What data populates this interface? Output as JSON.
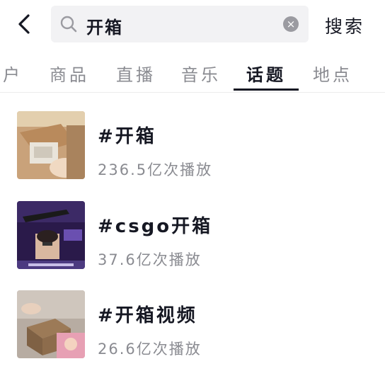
{
  "search": {
    "query": "开箱",
    "clear_icon": "×",
    "button_label": "搜索"
  },
  "tabs": [
    {
      "label": "户"
    },
    {
      "label": "商品"
    },
    {
      "label": "直播"
    },
    {
      "label": "音乐"
    },
    {
      "label": "话题",
      "active": true
    },
    {
      "label": "地点"
    }
  ],
  "topics": [
    {
      "title": "#开箱",
      "plays": "236.5亿次播放"
    },
    {
      "title": "#csgo开箱",
      "plays": "37.6亿次播放"
    },
    {
      "title": "#开箱视频",
      "plays": "26.6亿次播放"
    }
  ],
  "icons": {
    "back": "chevron-left-icon",
    "search": "search-icon",
    "clear": "clear-icon"
  }
}
